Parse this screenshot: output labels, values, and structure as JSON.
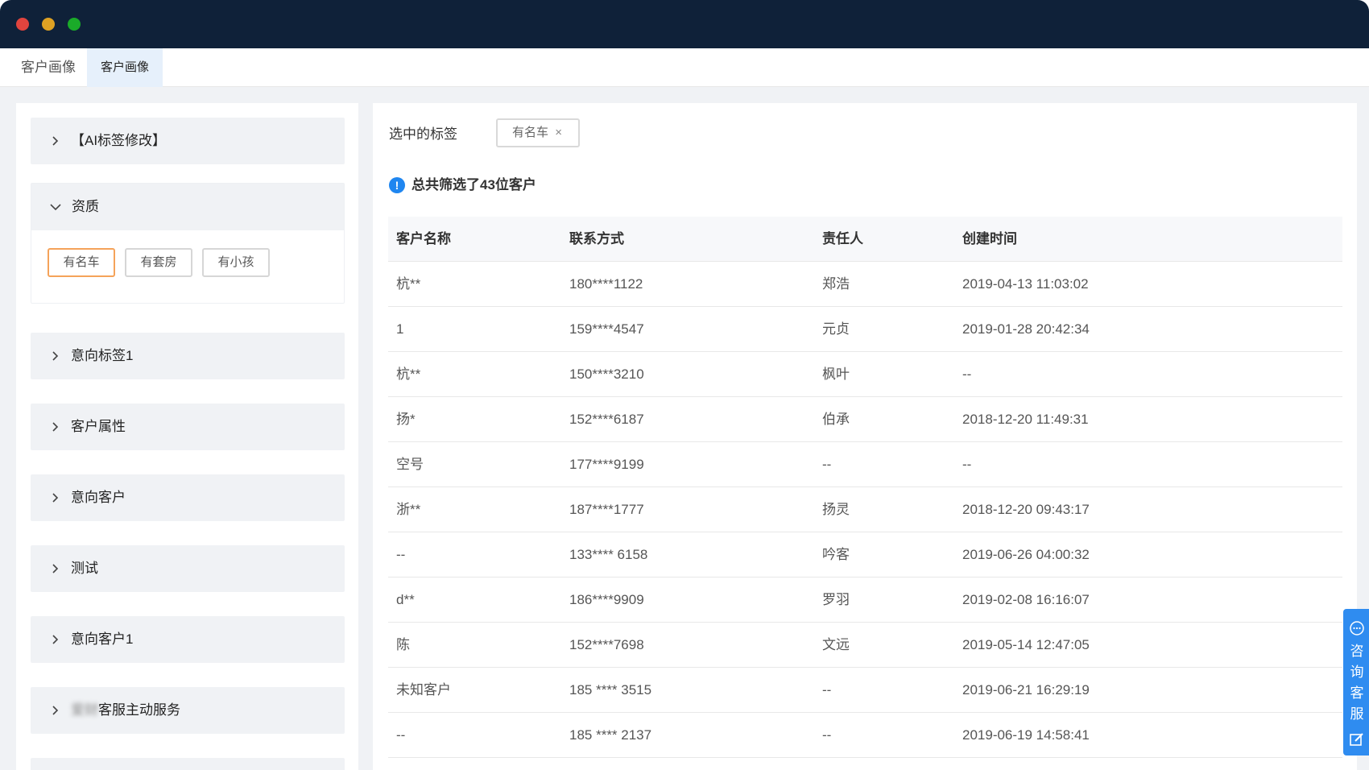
{
  "tabs": [
    {
      "label": "客户画像"
    },
    {
      "label": "客户画像"
    }
  ],
  "sidebar": {
    "categories": [
      {
        "label": "【AI标签修改】",
        "expanded": false
      },
      {
        "label": "资质",
        "expanded": true,
        "tags": [
          "有名车",
          "有套房",
          "有小孩"
        ],
        "selected_tag": "有名车"
      },
      {
        "label": "意向标签1",
        "expanded": false
      },
      {
        "label": "客户属性",
        "expanded": false
      },
      {
        "label": "意向客户",
        "expanded": false
      },
      {
        "label": "测试",
        "expanded": false
      },
      {
        "label": "意向客户1",
        "expanded": false
      },
      {
        "label_blurred": "爱财",
        "label": "客服主动服务",
        "expanded": false
      }
    ]
  },
  "main": {
    "selected_label": "选中的标签",
    "selected_chip": "有名车",
    "close_glyph": "×",
    "info_glyph": "!",
    "summary": "总共筛选了43位客户",
    "columns": [
      "客户名称",
      "联系方式",
      "责任人",
      "创建时间"
    ],
    "rows": [
      [
        "杭**",
        "180****1122",
        "郑浩",
        "2019-04-13 11:03:02"
      ],
      [
        "1",
        "159****4547",
        "元贞",
        "2019-01-28 20:42:34"
      ],
      [
        "杭**",
        "150****3210",
        "枫叶",
        "--"
      ],
      [
        "扬*",
        "152****6187",
        "伯承",
        "2018-12-20 11:49:31"
      ],
      [
        "空号",
        "177****9199",
        "--",
        "--"
      ],
      [
        "浙**",
        "187****1777",
        "扬灵",
        "2018-12-20 09:43:17"
      ],
      [
        "--",
        "133**** 6158",
        "吟客",
        "2019-06-26 04:00:32"
      ],
      [
        "d**",
        "186****9909",
        "罗羽",
        "2019-02-08 16:16:07"
      ],
      [
        "陈",
        "152****7698",
        "文远",
        "2019-05-14 12:47:05"
      ],
      [
        "未知客户",
        "185 **** 3515",
        "--",
        "2019-06-21 16:29:19"
      ],
      [
        "--",
        "185 **** 2137",
        "--",
        "2019-06-19 14:58:41"
      ]
    ]
  },
  "float_service": {
    "label": "咨询客服",
    "icons": [
      "chat-icon",
      "edit-icon"
    ]
  },
  "colors": {
    "titlebar": "#0f2139",
    "accent": "#2f8cf0",
    "selected_border": "#f5a35a",
    "tab_active_bg": "#e6f0fb"
  }
}
